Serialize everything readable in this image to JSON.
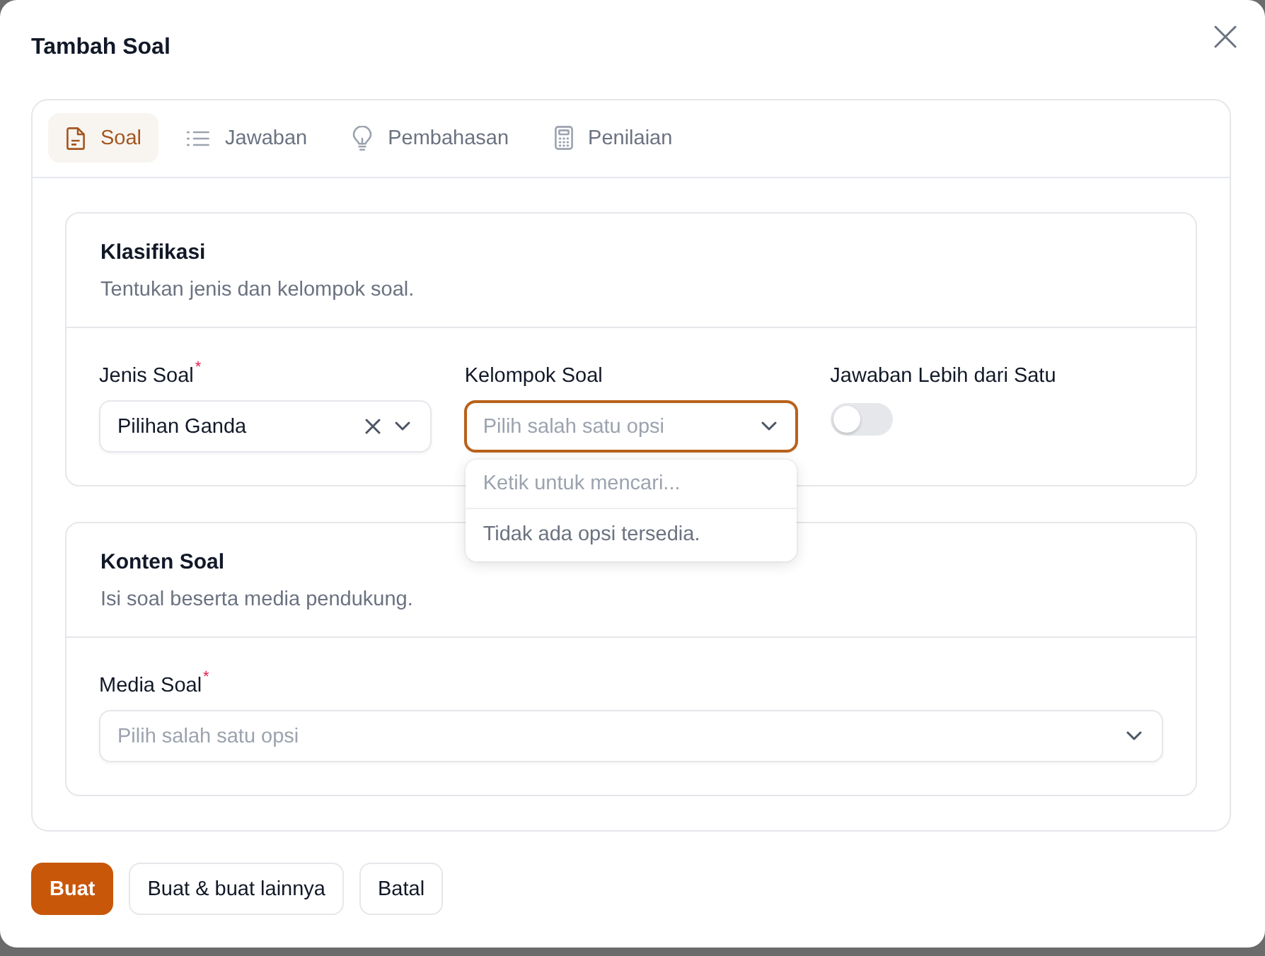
{
  "dialog": {
    "title": "Tambah Soal"
  },
  "tabs": [
    {
      "label": "Soal",
      "selected": true
    },
    {
      "label": "Jawaban",
      "selected": false
    },
    {
      "label": "Pembahasan",
      "selected": false
    },
    {
      "label": "Penilaian",
      "selected": false
    }
  ],
  "sections": [
    {
      "title": "Klasifikasi",
      "description": "Tentukan jenis dan kelompok soal.",
      "fields": [
        {
          "kind": "select",
          "label": "Jenis Soal",
          "required_mark": "*",
          "value": "Pilihan Ganda",
          "clearable": true,
          "focused": false
        },
        {
          "kind": "select",
          "label": "Kelompok Soal",
          "placeholder": "Pilih salah satu opsi",
          "clearable": false,
          "focused": true,
          "dropdown": {
            "search_placeholder": "Ketik untuk mencari...",
            "empty_message": "Tidak ada opsi tersedia."
          }
        },
        {
          "kind": "toggle",
          "label": "Jawaban Lebih dari Satu",
          "on": false
        }
      ]
    },
    {
      "title": "Konten Soal",
      "description": "Isi soal beserta media pendukung.",
      "fields": [
        {
          "kind": "select",
          "label": "Media Soal",
          "required_mark": "*",
          "placeholder": "Pilih salah satu opsi",
          "clearable": false,
          "focused": false
        }
      ]
    }
  ],
  "buttons": [
    {
      "label": "Buat",
      "primary": true
    },
    {
      "label": "Buat & buat lainnya",
      "primary": false
    },
    {
      "label": "Batal",
      "primary": false
    }
  ]
}
